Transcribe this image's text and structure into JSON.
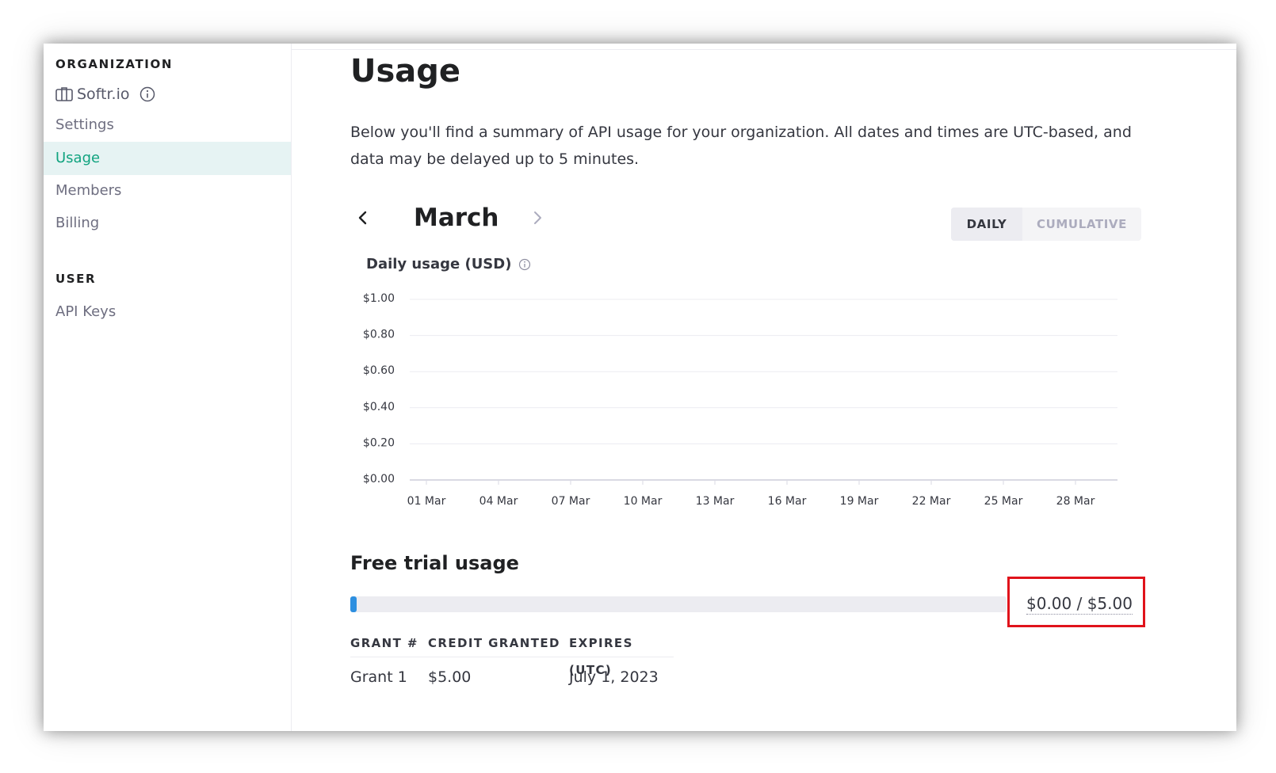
{
  "sidebar": {
    "org_heading": "ORGANIZATION",
    "org_name": "Softr.io",
    "items": [
      {
        "label": "Settings",
        "active": false
      },
      {
        "label": "Usage",
        "active": true
      },
      {
        "label": "Members",
        "active": false
      },
      {
        "label": "Billing",
        "active": false
      }
    ],
    "user_heading": "USER",
    "user_items": [
      {
        "label": "API Keys"
      }
    ]
  },
  "main": {
    "title": "Usage",
    "description": "Below you'll find a summary of API usage for your organization. All dates and times are UTC-based, and data may be delayed up to 5 minutes.",
    "month": "March",
    "toggle": {
      "daily": "DAILY",
      "cumulative": "CUMULATIVE",
      "selected": "DAILY"
    },
    "chart_title": "Daily usage (USD)"
  },
  "chart_data": {
    "type": "bar",
    "title": "Daily usage (USD)",
    "xlabel": "",
    "ylabel": "",
    "ylim": [
      0,
      1
    ],
    "yticks": [
      "$0.00",
      "$0.20",
      "$0.40",
      "$0.60",
      "$0.80",
      "$1.00"
    ],
    "ytick_values": [
      0,
      0.2,
      0.4,
      0.6,
      0.8,
      1.0
    ],
    "xticks": [
      "01 Mar",
      "04 Mar",
      "07 Mar",
      "10 Mar",
      "13 Mar",
      "16 Mar",
      "19 Mar",
      "22 Mar",
      "25 Mar",
      "28 Mar"
    ],
    "grid": true,
    "series": [
      {
        "values": [
          0,
          0,
          0,
          0,
          0,
          0,
          0,
          0,
          0,
          0,
          0,
          0,
          0,
          0,
          0,
          0,
          0,
          0,
          0,
          0,
          0,
          0,
          0,
          0,
          0,
          0,
          0,
          0,
          0,
          0,
          0
        ]
      }
    ]
  },
  "free_trial": {
    "title": "Free trial usage",
    "used": 0.0,
    "total": 5.0,
    "value_text": "$0.00 / $5.00",
    "bar_color": "#2d8fe0",
    "highlight_color": "#e0131b",
    "headers": {
      "grant": "GRANT #",
      "credit": "CREDIT GRANTED",
      "expires": "EXPIRES (UTC)"
    },
    "grants": [
      {
        "grant": "Grant 1",
        "credit": "$5.00",
        "expires": "July 1, 2023"
      }
    ]
  },
  "colors": {
    "accent": "#10a37f",
    "active_bg": "#e6f3f3"
  }
}
